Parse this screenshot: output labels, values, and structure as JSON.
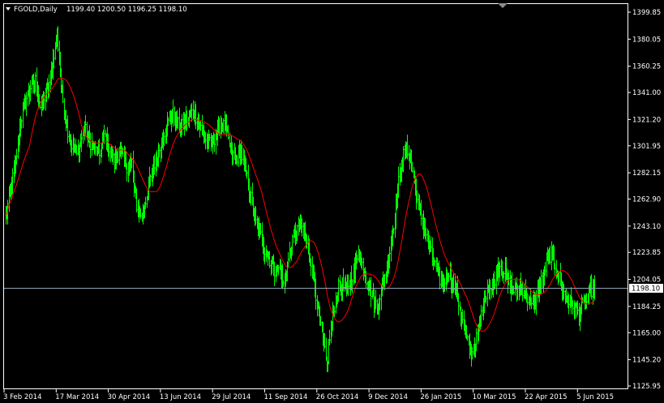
{
  "header": {
    "symbol_timeframe": "FGOLD,Daily",
    "ohlc": "1199.40 1200.50 1196.25 1198.10"
  },
  "current_price_label": "1198.10",
  "colors": {
    "background": "#000000",
    "bars": "#00ff00",
    "moving_average": "#ff0000",
    "axis": "#ffffff",
    "price_line": "#8ea3b6"
  },
  "chart_data": {
    "type": "ohlc",
    "symbol": "FGOLD",
    "timeframe": "Daily",
    "ylim": [
      1125.95,
      1399.85
    ],
    "y_tick_labels": [
      "1399.85",
      "1380.05",
      "1360.25",
      "1341.00",
      "1321.20",
      "1301.95",
      "1282.15",
      "1262.90",
      "1243.10",
      "1223.85",
      "1204.05",
      "1184.25",
      "1165.00",
      "1145.20",
      "1125.95"
    ],
    "x_tick_labels": [
      "3 Feb 2014",
      "17 Mar 2014",
      "30 Apr 2014",
      "13 Jun 2014",
      "29 Jul 2014",
      "11 Sep 2014",
      "26 Oct 2014",
      "9 Dec 2014",
      "26 Jan 2015",
      "10 Mar 2015",
      "22 Apr 2015",
      "5 Jun 2015"
    ],
    "price_keypoints": [
      [
        0,
        1250
      ],
      [
        5,
        1270
      ],
      [
        10,
        1290
      ],
      [
        15,
        1320
      ],
      [
        20,
        1335
      ],
      [
        25,
        1345
      ],
      [
        30,
        1350
      ],
      [
        35,
        1330
      ],
      [
        40,
        1340
      ],
      [
        45,
        1350
      ],
      [
        52,
        1385
      ],
      [
        56,
        1345
      ],
      [
        60,
        1325
      ],
      [
        64,
        1310
      ],
      [
        68,
        1300
      ],
      [
        72,
        1295
      ],
      [
        76,
        1305
      ],
      [
        80,
        1315
      ],
      [
        85,
        1305
      ],
      [
        90,
        1300
      ],
      [
        95,
        1295
      ],
      [
        100,
        1310
      ],
      [
        105,
        1300
      ],
      [
        110,
        1290
      ],
      [
        115,
        1298
      ],
      [
        120,
        1293
      ],
      [
        124,
        1285
      ],
      [
        128,
        1290
      ],
      [
        130,
        1270
      ],
      [
        134,
        1255
      ],
      [
        138,
        1250
      ],
      [
        142,
        1262
      ],
      [
        146,
        1275
      ],
      [
        150,
        1285
      ],
      [
        154,
        1295
      ],
      [
        158,
        1305
      ],
      [
        162,
        1315
      ],
      [
        166,
        1320
      ],
      [
        170,
        1325
      ],
      [
        174,
        1318
      ],
      [
        178,
        1315
      ],
      [
        182,
        1320
      ],
      [
        186,
        1322
      ],
      [
        190,
        1328
      ],
      [
        194,
        1322
      ],
      [
        198,
        1315
      ],
      [
        202,
        1308
      ],
      [
        206,
        1303
      ],
      [
        210,
        1305
      ],
      [
        214,
        1310
      ],
      [
        218,
        1318
      ],
      [
        222,
        1316
      ],
      [
        226,
        1305
      ],
      [
        230,
        1295
      ],
      [
        234,
        1292
      ],
      [
        238,
        1300
      ],
      [
        242,
        1288
      ],
      [
        246,
        1275
      ],
      [
        250,
        1260
      ],
      [
        254,
        1245
      ],
      [
        258,
        1238
      ],
      [
        262,
        1228
      ],
      [
        266,
        1222
      ],
      [
        270,
        1215
      ],
      [
        274,
        1210
      ],
      [
        278,
        1212
      ],
      [
        282,
        1200
      ],
      [
        286,
        1215
      ],
      [
        290,
        1228
      ],
      [
        294,
        1238
      ],
      [
        298,
        1245
      ],
      [
        302,
        1240
      ],
      [
        306,
        1228
      ],
      [
        310,
        1218
      ],
      [
        314,
        1200
      ],
      [
        318,
        1175
      ],
      [
        322,
        1160
      ],
      [
        326,
        1140
      ],
      [
        330,
        1168
      ],
      [
        334,
        1185
      ],
      [
        338,
        1198
      ],
      [
        342,
        1200
      ],
      [
        346,
        1195
      ],
      [
        350,
        1205
      ],
      [
        354,
        1210
      ],
      [
        358,
        1225
      ],
      [
        362,
        1215
      ],
      [
        366,
        1205
      ],
      [
        370,
        1198
      ],
      [
        374,
        1188
      ],
      [
        378,
        1185
      ],
      [
        382,
        1200
      ],
      [
        386,
        1210
      ],
      [
        390,
        1225
      ],
      [
        394,
        1245
      ],
      [
        398,
        1270
      ],
      [
        402,
        1290
      ],
      [
        406,
        1300
      ],
      [
        410,
        1295
      ],
      [
        414,
        1280
      ],
      [
        418,
        1262
      ],
      [
        422,
        1250
      ],
      [
        426,
        1240
      ],
      [
        430,
        1228
      ],
      [
        434,
        1218
      ],
      [
        438,
        1210
      ],
      [
        442,
        1202
      ],
      [
        446,
        1205
      ],
      [
        450,
        1210
      ],
      [
        454,
        1200
      ],
      [
        458,
        1195
      ],
      [
        462,
        1180
      ],
      [
        466,
        1165
      ],
      [
        470,
        1155
      ],
      [
        474,
        1150
      ],
      [
        478,
        1160
      ],
      [
        482,
        1175
      ],
      [
        486,
        1190
      ],
      [
        490,
        1200
      ],
      [
        494,
        1196
      ],
      [
        498,
        1208
      ],
      [
        502,
        1215
      ],
      [
        506,
        1210
      ],
      [
        510,
        1202
      ],
      [
        514,
        1198
      ],
      [
        518,
        1195
      ],
      [
        522,
        1200
      ],
      [
        526,
        1196
      ],
      [
        530,
        1190
      ],
      [
        534,
        1185
      ],
      [
        538,
        1188
      ],
      [
        542,
        1200
      ],
      [
        546,
        1205
      ],
      [
        550,
        1220
      ],
      [
        554,
        1222
      ],
      [
        558,
        1215
      ],
      [
        562,
        1205
      ],
      [
        566,
        1195
      ],
      [
        570,
        1190
      ],
      [
        574,
        1186
      ],
      [
        578,
        1183
      ],
      [
        582,
        1178
      ],
      [
        586,
        1185
      ],
      [
        590,
        1188
      ],
      [
        594,
        1196
      ],
      [
        598,
        1198
      ]
    ]
  }
}
